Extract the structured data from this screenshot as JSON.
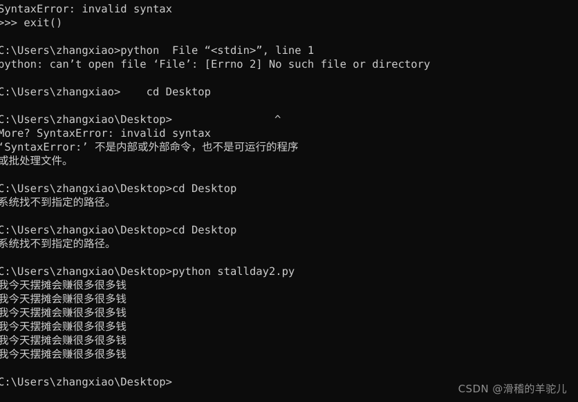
{
  "window": {
    "app": "Command Prompt",
    "background_color": "#0c0c0c",
    "text_color": "#cccccc"
  },
  "terminal": {
    "caret_marker": "^",
    "lines": [
      {
        "id": "l01",
        "text": "SyntaxError: invalid syntax"
      },
      {
        "id": "l02",
        "text": ">>> exit()"
      },
      {
        "id": "l03",
        "text": ""
      },
      {
        "id": "l04",
        "text": "C:\\Users\\zhangxiao>python  File “<stdin>”, line 1"
      },
      {
        "id": "l05",
        "text": "python: can’t open file ‘File’: [Errno 2] No such file or directory"
      },
      {
        "id": "l06",
        "text": ""
      },
      {
        "id": "l07",
        "text": "C:\\Users\\zhangxiao>    cd Desktop"
      },
      {
        "id": "l08",
        "text": ""
      },
      {
        "id": "l09",
        "text": "C:\\Users\\zhangxiao\\Desktop>",
        "caret": true
      },
      {
        "id": "l10",
        "text": "More? SyntaxError: invalid syntax"
      },
      {
        "id": "l11",
        "text": "‘SyntaxError:’ 不是内部或外部命令，也不是可运行的程序"
      },
      {
        "id": "l12",
        "text": "或批处理文件。"
      },
      {
        "id": "l13",
        "text": ""
      },
      {
        "id": "l14",
        "text": "C:\\Users\\zhangxiao\\Desktop>cd Desktop"
      },
      {
        "id": "l15",
        "text": "系统找不到指定的路径。"
      },
      {
        "id": "l16",
        "text": ""
      },
      {
        "id": "l17",
        "text": "C:\\Users\\zhangxiao\\Desktop>cd Desktop"
      },
      {
        "id": "l18",
        "text": "系统找不到指定的路径。"
      },
      {
        "id": "l19",
        "text": ""
      },
      {
        "id": "l20",
        "text": "C:\\Users\\zhangxiao\\Desktop>python stallday2.py"
      },
      {
        "id": "l21",
        "text": "我今天摆摊会赚很多很多钱"
      },
      {
        "id": "l22",
        "text": "我今天摆摊会赚很多很多钱"
      },
      {
        "id": "l23",
        "text": "我今天摆摊会赚很多很多钱"
      },
      {
        "id": "l24",
        "text": "我今天摆摊会赚很多很多钱"
      },
      {
        "id": "l25",
        "text": "我今天摆摊会赚很多很多钱"
      },
      {
        "id": "l26",
        "text": "我今天摆摊会赚很多很多钱"
      },
      {
        "id": "l27",
        "text": ""
      },
      {
        "id": "l28",
        "text": "C:\\Users\\zhangxiao\\Desktop>"
      }
    ]
  },
  "watermark": {
    "text": "CSDN @滑稽的羊驼儿",
    "color": "#8e8e8e"
  }
}
